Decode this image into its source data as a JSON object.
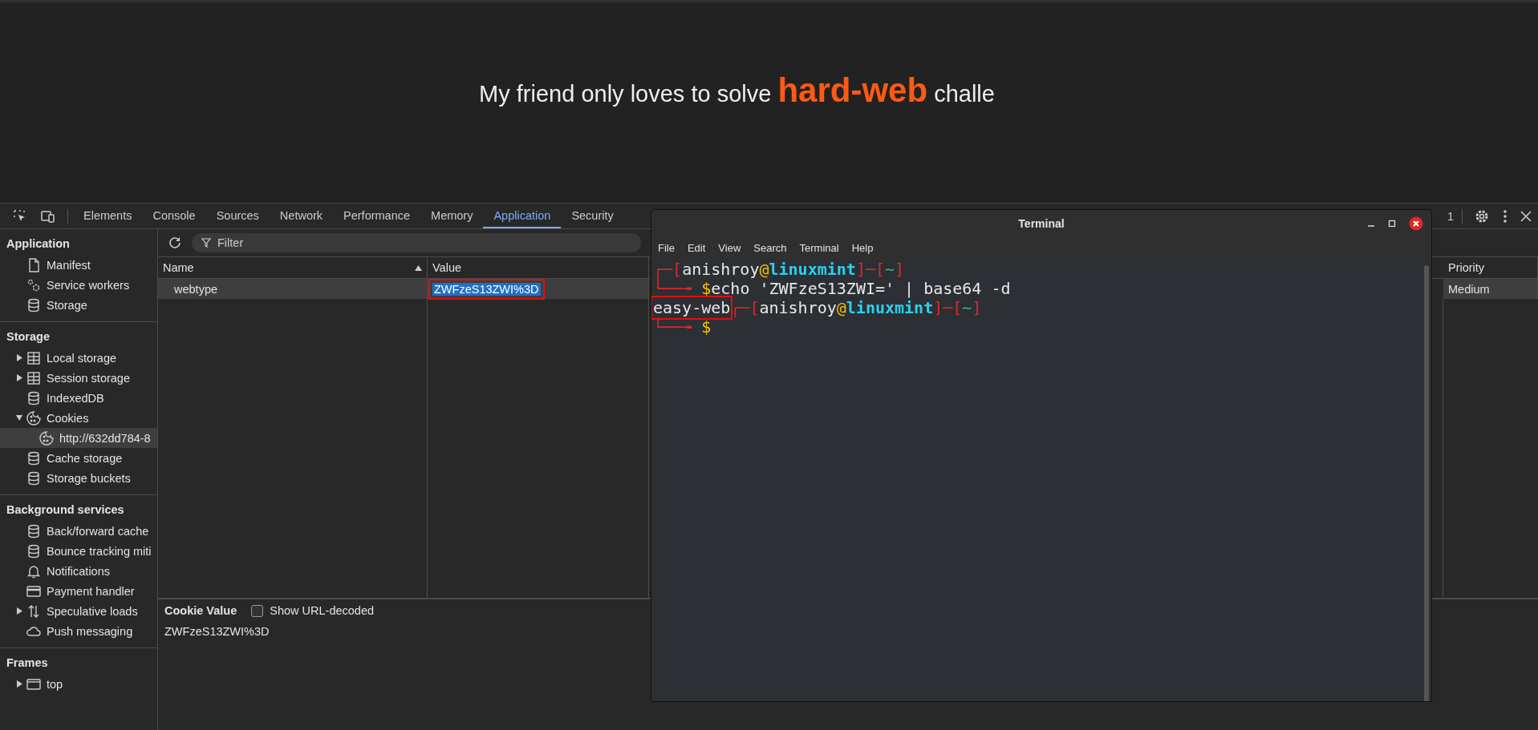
{
  "page": {
    "heading": {
      "before": "My friend only loves to solve ",
      "emphasis": "hard-web",
      "after": " challe"
    }
  },
  "devtools": {
    "tabs": [
      {
        "label": "Elements",
        "selected": false
      },
      {
        "label": "Console",
        "selected": false
      },
      {
        "label": "Sources",
        "selected": false
      },
      {
        "label": "Network",
        "selected": false
      },
      {
        "label": "Performance",
        "selected": false
      },
      {
        "label": "Memory",
        "selected": false
      },
      {
        "label": "Application",
        "selected": true
      },
      {
        "label": "Security",
        "selected": false
      }
    ],
    "issues_count": "1",
    "sidebar": {
      "sections": [
        {
          "title": "Application",
          "items": [
            {
              "label": "Manifest",
              "kind": "file",
              "selected": false
            },
            {
              "label": "Service workers",
              "kind": "gears",
              "selected": false
            },
            {
              "label": "Storage",
              "kind": "database",
              "selected": false
            }
          ]
        },
        {
          "title": "Storage",
          "items": [
            {
              "label": "Local storage",
              "kind": "table",
              "expanded": false,
              "selected": false
            },
            {
              "label": "Session storage",
              "kind": "table",
              "expanded": false,
              "selected": false
            },
            {
              "label": "IndexedDB",
              "kind": "database",
              "selected": false
            },
            {
              "label": "Cookies",
              "kind": "cookie",
              "expanded": true,
              "selected": false,
              "children": [
                {
                  "label": "http://632dd784-8",
                  "kind": "cookie",
                  "selected": true
                }
              ]
            },
            {
              "label": "Cache storage",
              "kind": "database",
              "selected": false
            },
            {
              "label": "Storage buckets",
              "kind": "database",
              "selected": false
            }
          ]
        },
        {
          "title": "Background services",
          "items": [
            {
              "label": "Back/forward cache",
              "kind": "database",
              "selected": false
            },
            {
              "label": "Bounce tracking miti",
              "kind": "database",
              "selected": false
            },
            {
              "label": "Notifications",
              "kind": "bell",
              "selected": false
            },
            {
              "label": "Payment handler",
              "kind": "card",
              "selected": false
            },
            {
              "label": "Speculative loads",
              "kind": "arrows",
              "expanded": false,
              "selected": false
            },
            {
              "label": "Push messaging",
              "kind": "cloud",
              "selected": false
            }
          ]
        },
        {
          "title": "Frames",
          "items": [
            {
              "label": "top",
              "kind": "frame",
              "expanded": false,
              "selected": false
            }
          ]
        }
      ]
    },
    "filter": {
      "placeholder": "Filter"
    },
    "table": {
      "columns": [
        {
          "label": "Name",
          "sorted": true
        },
        {
          "label": "Value",
          "sorted": false
        },
        {
          "label": "Priority",
          "sorted": false
        }
      ],
      "rows": [
        {
          "cells": [
            "webtype",
            "ZWFzeS13ZWI%3D",
            "Medium"
          ],
          "selected": true,
          "value_selected": true
        }
      ]
    },
    "cookie_value": {
      "title": "Cookie Value",
      "show_url_decoded": {
        "label": "Show URL-decoded",
        "checked": false
      },
      "value": "ZWFzeS13ZWI%3D"
    }
  },
  "terminal": {
    "title": "Terminal",
    "menu": [
      "File",
      "Edit",
      "View",
      "Search",
      "Terminal",
      "Help"
    ],
    "lines": [
      [
        {
          "text": "┌─[",
          "kind": "frame"
        },
        {
          "text": "anishroy",
          "kind": "user"
        },
        {
          "text": "@",
          "kind": "at"
        },
        {
          "text": "linuxmint",
          "kind": "host"
        },
        {
          "text": "]─[",
          "kind": "frame"
        },
        {
          "text": "~",
          "kind": "dir"
        },
        {
          "text": "]",
          "kind": "frame"
        }
      ],
      [
        {
          "text": "└──╼ ",
          "kind": "frame"
        },
        {
          "text": "$",
          "kind": "at"
        },
        {
          "text": "echo 'ZWFzeS13ZWI=' | base64 -d",
          "kind": "plain"
        }
      ],
      [
        {
          "text": "easy-web",
          "kind": "marked"
        },
        {
          "text": "┌─[",
          "kind": "frame"
        },
        {
          "text": "anishroy",
          "kind": "user"
        },
        {
          "text": "@",
          "kind": "at"
        },
        {
          "text": "linuxmint",
          "kind": "host"
        },
        {
          "text": "]─[",
          "kind": "frame"
        },
        {
          "text": "~",
          "kind": "dir"
        },
        {
          "text": "]",
          "kind": "frame"
        }
      ],
      [
        {
          "text": "└──╼ ",
          "kind": "frame"
        },
        {
          "text": "$",
          "kind": "at"
        }
      ]
    ]
  }
}
